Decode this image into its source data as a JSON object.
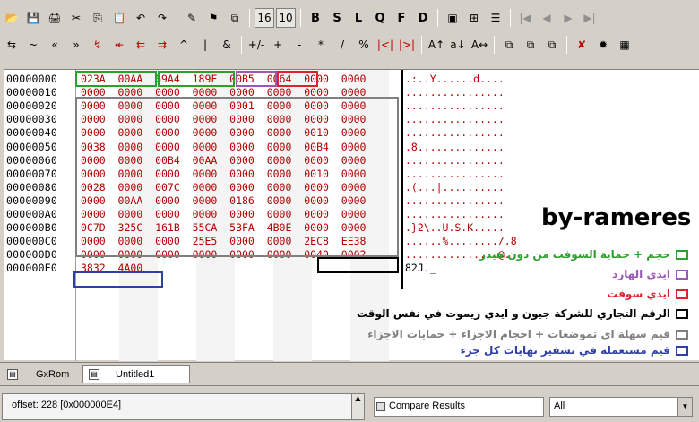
{
  "toolbar1": {
    "groups": [
      [
        "📂",
        "💾",
        "🖨",
        "✂",
        "⎘",
        "📋",
        "↶",
        "↷"
      ],
      [
        "✎",
        "⚑",
        "⧉"
      ],
      [
        "16",
        "10"
      ],
      [
        "B",
        "S",
        "L",
        "Q",
        "F",
        "D"
      ],
      [
        "▣",
        "⊞",
        "☰"
      ],
      [
        "|◀",
        "◀",
        "▶",
        "▶|"
      ]
    ]
  },
  "toolbar2": {
    "groups": [
      [
        "⇆",
        "~",
        "«",
        "»",
        "↯",
        "↞",
        "⇇",
        "⇉",
        "^",
        "|",
        "&"
      ],
      [
        "+/-",
        "+",
        "-",
        "*",
        "/",
        "%",
        "|<|",
        "|>|"
      ],
      [
        "A↑",
        "a↓",
        "A↔"
      ],
      [
        "⧉",
        "⧉",
        "⧉"
      ],
      [
        "✘",
        "✹",
        "▦"
      ]
    ]
  },
  "addresses": [
    "00000000",
    "00000010",
    "00000020",
    "00000030",
    "00000040",
    "00000050",
    "00000060",
    "00000070",
    "00000080",
    "00000090",
    "000000A0",
    "000000B0",
    "000000C0",
    "000000D0",
    "000000E0"
  ],
  "hex_rows": [
    "023A  00AA  69A4  189F  00B5  0064  0000  0000",
    "0000  0000  0000  0000  0000  0000  0000  0000",
    "0000  0000  0000  0000  0001  0000  0000  0000",
    "0000  0000  0000  0000  0000  0000  0000  0000",
    "0000  0000  0000  0000  0000  0000  0010  0000",
    "0038  0000  0000  0000  0000  0000  00B4  0000",
    "0000  0000  00B4  00AA  0000  0000  0000  0000",
    "0000  0000  0000  0000  0000  0000  0010  0000",
    "0028  0000  007C  0000  0000  0000  0000  0000",
    "0000  00AA  0000  0000  0186  0000  0000  0000",
    "0000  0000  0000  0000  0000  0000  0000  0000",
    "0C7D  325C  161B  55CA  53FA  4B0E  0000  0000",
    "0000  0000  0000  25E5  0000  0000  2EC8  EE38",
    "0000  0000  0000  0000  0000  0000  0040  0002",
    "3832  4A00"
  ],
  "ascii_rows": [
    ".:..Y......d....",
    "................",
    "................",
    "................",
    "................",
    ".8..............",
    "................",
    "................",
    ".(...|..........",
    "................",
    "................",
    ".}2\\..U.S.K.....",
    "......%......../.8",
    "...............@.",
    "82J._"
  ],
  "brand": "by-rameres",
  "legend": [
    {
      "text": "حجم + حماية السوفت من دون هيدر",
      "color": "#2ca02c"
    },
    {
      "text": "ايدي الهارد",
      "color": "#9b59b6"
    },
    {
      "text": "ايدي سوفت",
      "color": "#e0202e"
    },
    {
      "text": "الرقم التجاري للشركة جيون و ايدي ريموت في نفس الوقت",
      "color": "#000000"
    },
    {
      "text": "قيم سهلة اي تموضعات + احجام الاجزاء + حمايات الاجزاء",
      "color": "#808080"
    },
    {
      "text": "قيم مستعملة في تشفير نهايات كل جزء",
      "color": "#2f3fa8"
    }
  ],
  "tabs": [
    {
      "label": "GxRom"
    },
    {
      "label": "Untitled1"
    }
  ],
  "status": {
    "offset": "offset: 228 [0x000000E4]",
    "compare_label": "Compare Results",
    "compare_select": "All"
  }
}
